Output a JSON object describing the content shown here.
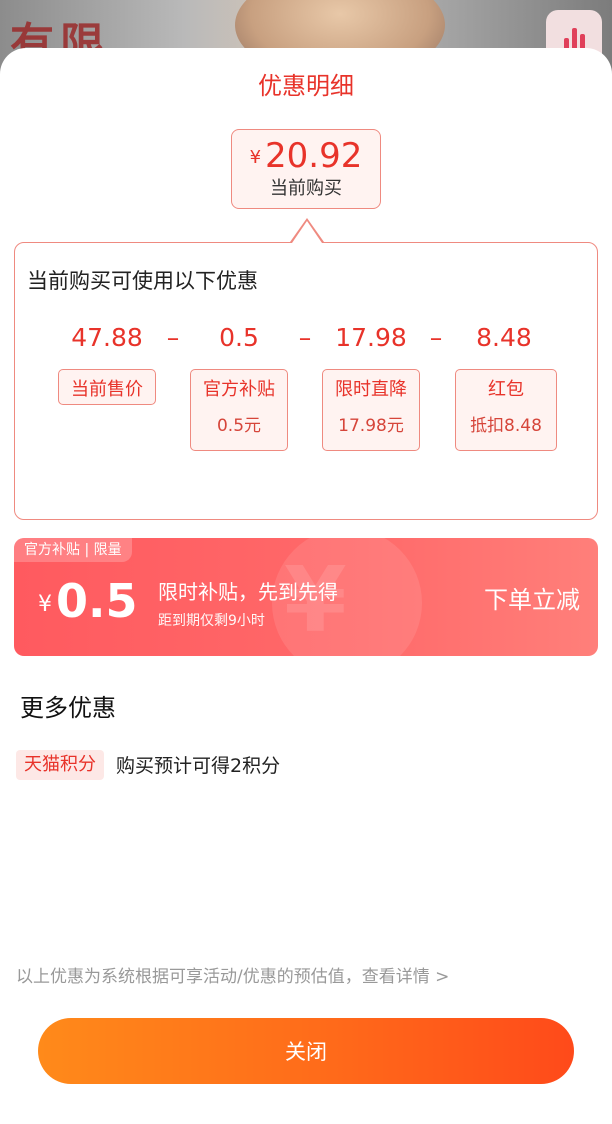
{
  "background": {
    "text": "有限"
  },
  "sheet": {
    "title": "优惠明细"
  },
  "current_price": {
    "symbol": "¥",
    "value": "20.92",
    "label": "当前购买"
  },
  "breakdown": {
    "heading": "当前购买可使用以下优惠",
    "operator": "–",
    "items": [
      {
        "value": "47.88",
        "tag": "当前售价",
        "sub": ""
      },
      {
        "value": "0.5",
        "tag": "官方补贴",
        "sub": "0.5元"
      },
      {
        "value": "17.98",
        "tag": "限时直降",
        "sub": "17.98元"
      },
      {
        "value": "8.48",
        "tag": "红包",
        "sub": "抵扣8.48"
      }
    ]
  },
  "subsidy": {
    "badge": "官方补贴 | 限量",
    "symbol": "¥",
    "amount": "0.5",
    "line1": "限时补贴，先到先得",
    "line2": "距到期仅剩9小时",
    "cta": "下单立减"
  },
  "more": {
    "title": "更多优惠",
    "tag": "天猫积分",
    "desc": "购买预计可得2积分"
  },
  "disclaimer": "以上优惠为系统根据可享活动/优惠的预估值，查看详情 >",
  "close_label": "关闭",
  "colors": {
    "accent": "#e8332a",
    "button_start": "#ff8a1a",
    "button_end": "#ff4a1a"
  }
}
